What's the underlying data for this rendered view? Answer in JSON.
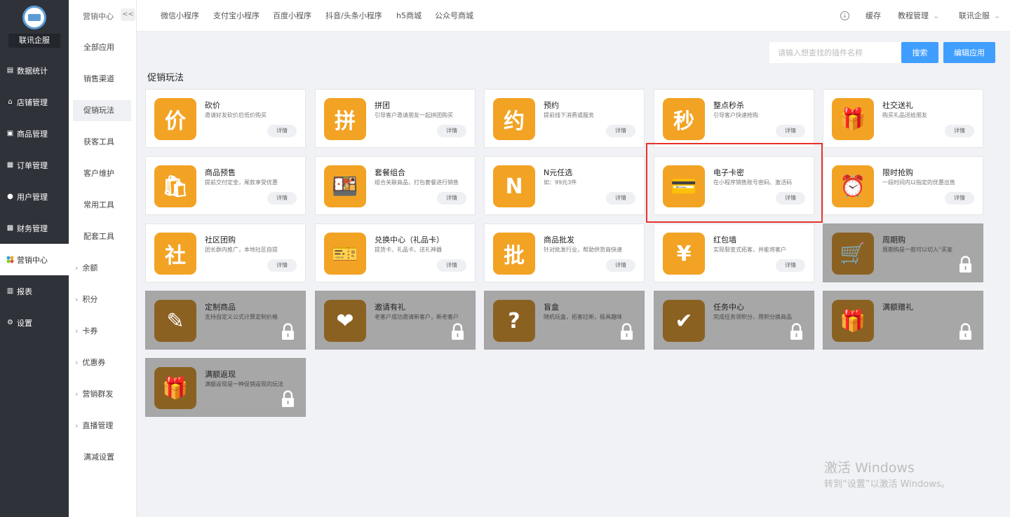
{
  "sidebar": {
    "brand": "联讯企服",
    "items": [
      {
        "label": "数据统计",
        "icon": "chart-icon"
      },
      {
        "label": "店铺管理",
        "icon": "shop-icon"
      },
      {
        "label": "商品管理",
        "icon": "goods-icon"
      },
      {
        "label": "订单管理",
        "icon": "order-icon"
      },
      {
        "label": "用户管理",
        "icon": "user-icon"
      },
      {
        "label": "财务管理",
        "icon": "finance-icon"
      },
      {
        "label": "营销中心",
        "icon": "marketing-icon",
        "active": true
      },
      {
        "label": "报表",
        "icon": "report-icon"
      },
      {
        "label": "设置",
        "icon": "settings-icon"
      }
    ]
  },
  "subnav": {
    "title": "营销中心",
    "collapse": "<<",
    "items": [
      {
        "label": "全部应用"
      },
      {
        "label": "销售渠道"
      },
      {
        "label": "促销玩法",
        "active": true
      },
      {
        "label": "获客工具"
      },
      {
        "label": "客户维护"
      },
      {
        "label": "常用工具"
      },
      {
        "label": "配套工具"
      },
      {
        "label": "余额",
        "expandable": true
      },
      {
        "label": "积分",
        "expandable": true
      },
      {
        "label": "卡券",
        "expandable": true
      },
      {
        "label": "优惠券",
        "expandable": true
      },
      {
        "label": "营销群发",
        "expandable": true
      },
      {
        "label": "直播管理",
        "expandable": true
      },
      {
        "label": "满减设置"
      }
    ]
  },
  "topbar": {
    "tabs": [
      "微信小程序",
      "支付宝小程序",
      "百度小程序",
      "抖音/头条小程序",
      "h5商城",
      "公众号商城"
    ],
    "cache": "缓存",
    "tutorial": "教程管理",
    "user": "联讯企服"
  },
  "search": {
    "placeholder": "请输入想查找的插件名称",
    "button": "搜索"
  },
  "edit_button": "编辑应用",
  "section_title": "促销玩法",
  "cards": [
    {
      "name": "砍价",
      "desc": "邀请好友砍价后低价购买",
      "glyph": "价",
      "detail": "详情",
      "locked": false
    },
    {
      "name": "拼团",
      "desc": "引导客户邀请朋友一起拼团购买",
      "glyph": "拼",
      "detail": "详情",
      "locked": false
    },
    {
      "name": "预约",
      "desc": "提前线下消费或服务",
      "glyph": "约",
      "detail": "详情",
      "locked": false
    },
    {
      "name": "整点秒杀",
      "desc": "引导客户快速抢购",
      "glyph": "秒",
      "detail": "详情",
      "locked": false
    },
    {
      "name": "社交送礼",
      "desc": "购买礼品送给朋友",
      "glyph": "🎁",
      "detail": "详情",
      "locked": false
    },
    {
      "name": "商品预售",
      "desc": "提前交付定金，尾款享受优惠",
      "glyph": "🛍",
      "detail": "详情",
      "locked": false
    },
    {
      "name": "套餐组合",
      "desc": "组合关联商品，打包套餐进行销售",
      "glyph": "🍱",
      "detail": "详情",
      "locked": false
    },
    {
      "name": "N元任选",
      "desc": "如：99元3件",
      "glyph": "N",
      "detail": "详情",
      "locked": false
    },
    {
      "name": "电子卡密",
      "desc": "在小程序销售账号密码、激活码",
      "glyph": "💳",
      "detail": "详情",
      "locked": false
    },
    {
      "name": "限时抢购",
      "desc": "一段时间内以指定的优惠出售",
      "glyph": "⏰",
      "detail": "详情",
      "locked": false
    },
    {
      "name": "社区团购",
      "desc": "团长群内推广，本地社区自提",
      "glyph": "社",
      "detail": "详情",
      "locked": false
    },
    {
      "name": "兑换中心（礼品卡）",
      "desc": "提货卡、礼品卡、送礼神器",
      "glyph": "🎫",
      "detail": "详情",
      "locked": false
    },
    {
      "name": "商品批发",
      "desc": "针对批发行业，帮助供货商快速",
      "glyph": "批",
      "detail": "详情",
      "locked": false
    },
    {
      "name": "红包墙",
      "desc": "实现裂变式拓客，并能将客户",
      "glyph": "¥",
      "detail": "详情",
      "locked": false
    },
    {
      "name": "周期购",
      "desc": "周期购是一款可以切入“买家",
      "glyph": "🛒",
      "locked": true
    },
    {
      "name": "定制商品",
      "desc": "支持自定义公式计算定制价格",
      "glyph": "✎",
      "locked": true
    },
    {
      "name": "邀请有礼",
      "desc": "老客户成功邀请新客户，新老客户",
      "glyph": "❤",
      "locked": true
    },
    {
      "name": "盲盒",
      "desc": "随机玩盒，拓客拉新，极具趣味",
      "glyph": "?",
      "locked": true
    },
    {
      "name": "任务中心",
      "desc": "完成任务领积分，用积分换商品",
      "glyph": "✔",
      "locked": true
    },
    {
      "name": "满额赠礼",
      "desc": "",
      "glyph": "🎁",
      "locked": true
    },
    {
      "name": "满额返现",
      "desc": "满额返现是一种促销返现的玩法",
      "glyph": "🎁",
      "locked": true
    }
  ],
  "watermark": {
    "line1": "激活 Windows",
    "line2": "转到“设置”以激活 Windows。"
  },
  "colors": {
    "accent": "#409eff",
    "icon_orange": "#f2a324",
    "locked_icon": "#8b6122",
    "locked_bg": "#a7a7a7",
    "highlight": "#e8322b",
    "sidebar_bg": "#2f3239"
  }
}
